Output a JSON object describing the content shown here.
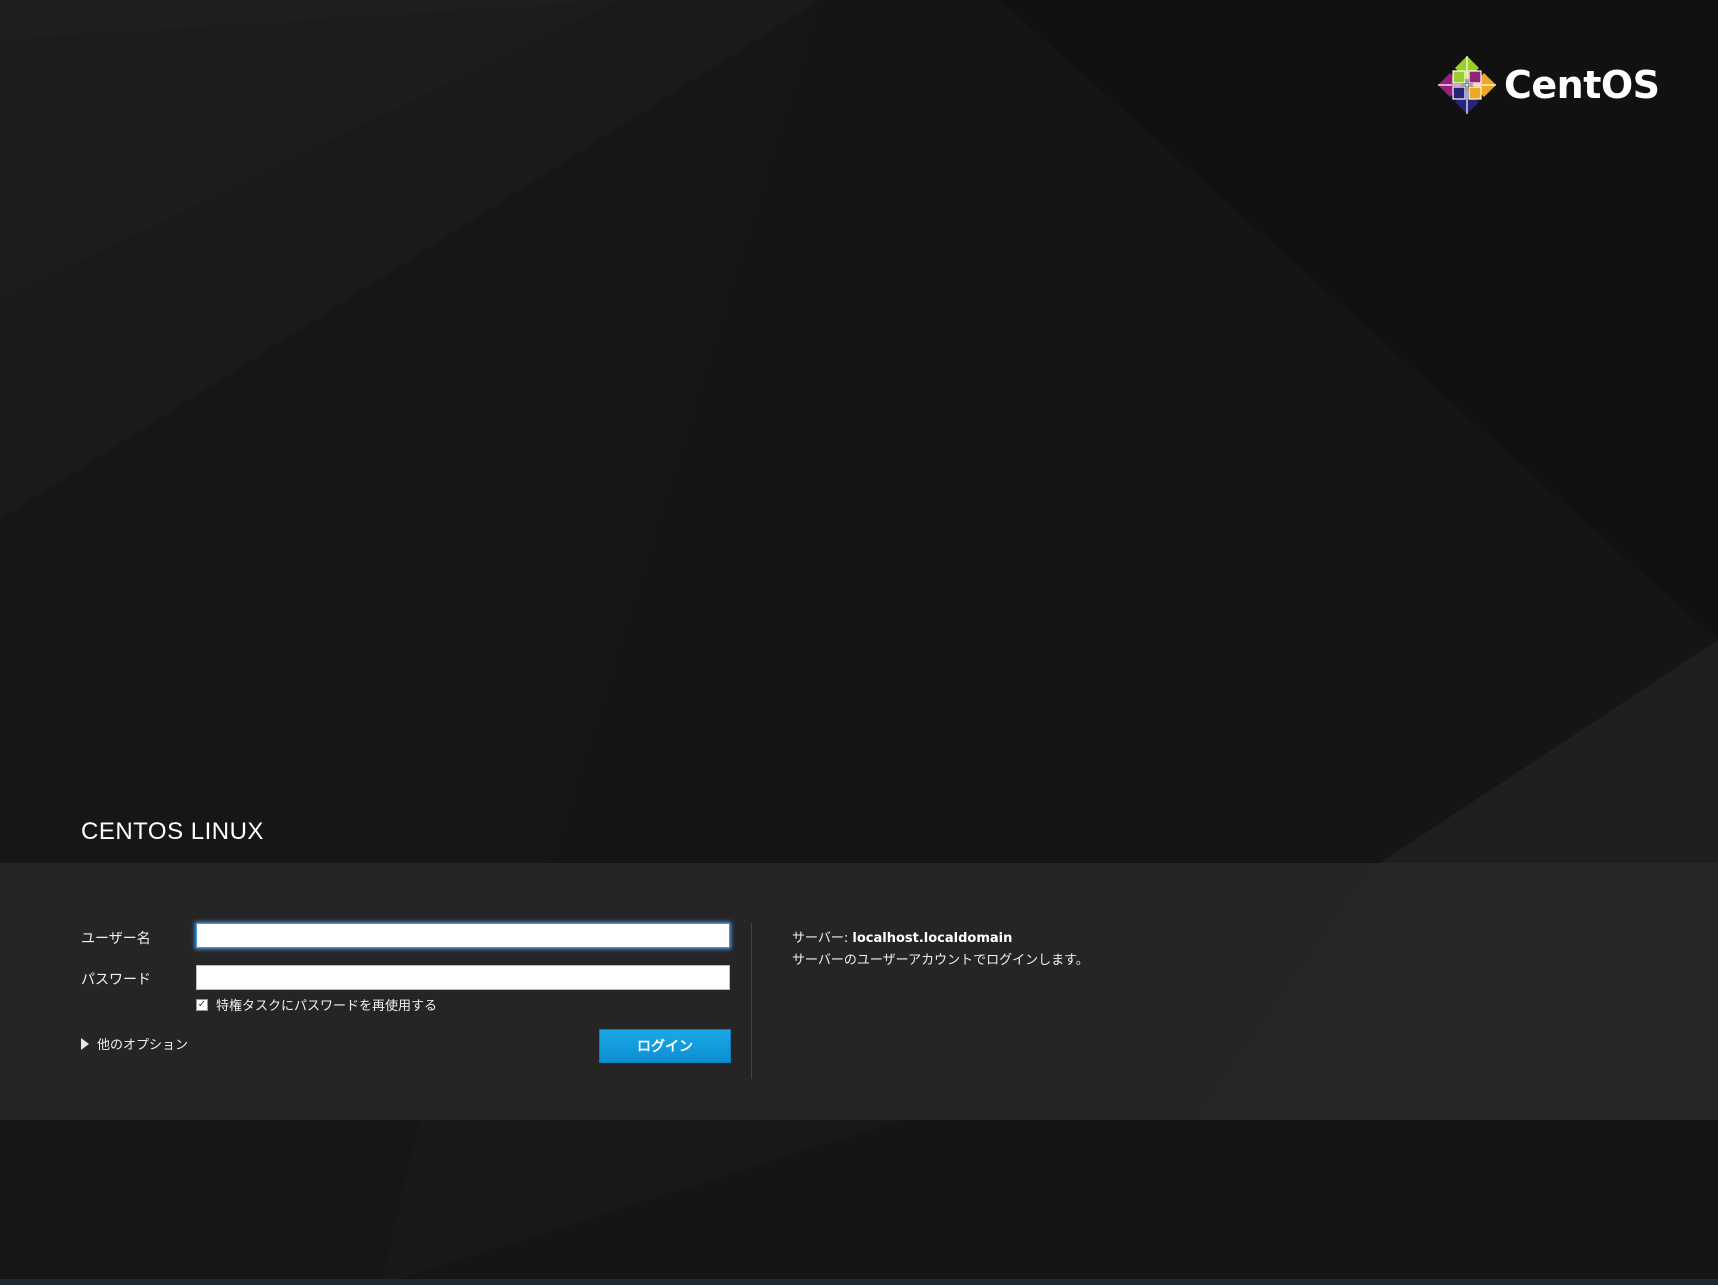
{
  "logo": {
    "name": "CentOS",
    "icon": "centos-logo-icon"
  },
  "brand": {
    "title": "CENTOS LINUX"
  },
  "login": {
    "username_label": "ユーザー名",
    "username_value": "",
    "password_label": "パスワード",
    "password_value": "",
    "reuse_password_label": "特権タスクにパスワードを再使用する",
    "reuse_password_checked": true,
    "other_options_label": "他のオプション",
    "login_button_label": "ログイン"
  },
  "server": {
    "label": "サーバー:",
    "name": "localhost.localdomain",
    "description": "サーバーのユーザーアカウントでログインします。"
  },
  "colors": {
    "background": "#141414",
    "panel": "#282828",
    "accent": "#1aa8e8",
    "focus_glow": "#54aaff"
  }
}
